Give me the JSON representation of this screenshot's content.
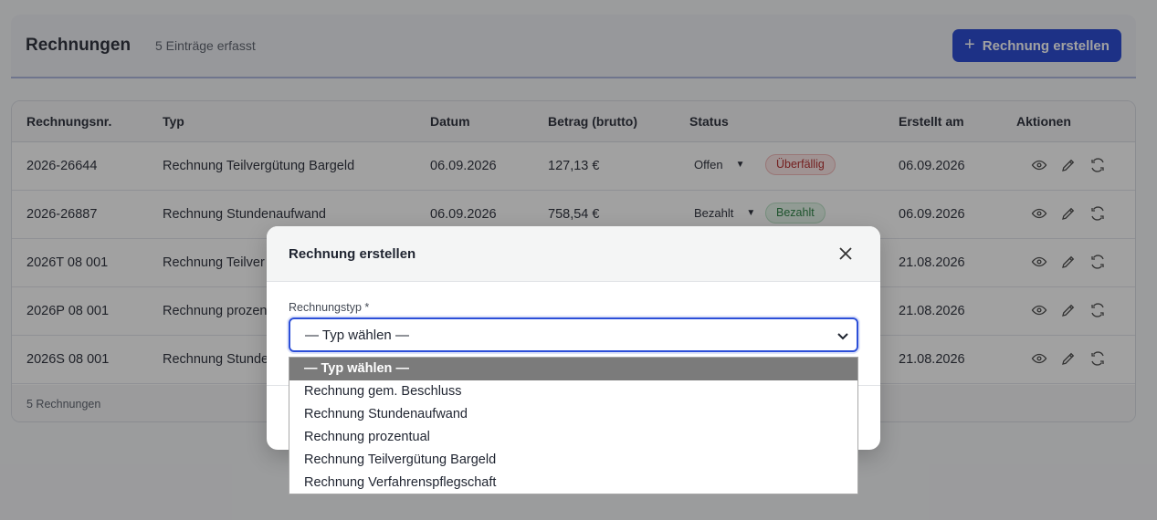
{
  "header": {
    "title": "Rechnungen",
    "subtitle": "5 Einträge erfasst",
    "create_button": "Rechnung erstellen"
  },
  "table": {
    "columns": [
      "Rechnungsnr.",
      "Typ",
      "Datum",
      "Betrag (brutto)",
      "Status",
      "Erstellt am",
      "Aktionen"
    ],
    "rows": [
      {
        "nr": "2026-26644",
        "typ": "Rechnung Teilvergütung Bargeld",
        "datum": "06.09.2026",
        "betrag": "127,13 €",
        "status": "Offen",
        "badge": "Überfällig",
        "erstellt": "06.09.2026"
      },
      {
        "nr": "2026-26887",
        "typ": "Rechnung Stundenaufwand",
        "datum": "06.09.2026",
        "betrag": "758,54 €",
        "status": "Bezahlt",
        "badge": "Bezahlt",
        "erstellt": "06.09.2026"
      },
      {
        "nr": "2026T 08 001",
        "typ": "Rechnung Teilver",
        "datum": "",
        "betrag": "",
        "status": "",
        "badge": "",
        "erstellt": "21.08.2026"
      },
      {
        "nr": "2026P 08 001",
        "typ": "Rechnung prozen",
        "datum": "",
        "betrag": "",
        "status": "",
        "badge": "",
        "erstellt": "21.08.2026"
      },
      {
        "nr": "2026S 08 001",
        "typ": "Rechnung Stunde",
        "datum": "",
        "betrag": "",
        "status": "",
        "badge": "",
        "erstellt": "21.08.2026"
      }
    ],
    "footer": "5 Rechnungen"
  },
  "modal": {
    "title": "Rechnung erstellen",
    "field_label": "Rechnungstyp *",
    "selected_value": "— Typ wählen —",
    "options": [
      "— Typ wählen —",
      "Rechnung gem. Beschluss",
      "Rechnung Stundenaufwand",
      "Rechnung prozentual",
      "Rechnung Teilvergütung Bargeld",
      "Rechnung Verfahrenspflegschaft"
    ]
  },
  "colors": {
    "accent": "#1d3fd1",
    "overdue": "#b22222",
    "paid": "#1f7a3a"
  },
  "icons": {
    "view": "eye-icon",
    "edit": "pencil-icon",
    "refresh": "refresh-icon",
    "close": "close-icon",
    "add": "plus-icon",
    "dropdown": "chevron-down-icon"
  }
}
